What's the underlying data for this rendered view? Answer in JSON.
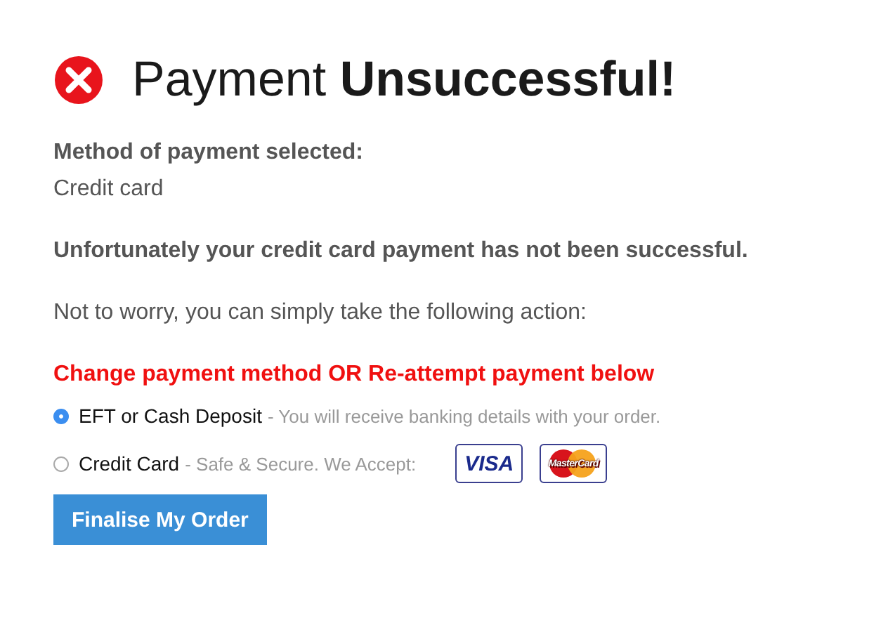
{
  "title": {
    "prefix": "Payment",
    "emphasis": "Unsuccessful!"
  },
  "method_label": "Method of payment selected:",
  "method_value": "Credit card",
  "failure_message": "Unfortunately your credit card payment has not been successful.",
  "info_message": "Not to worry, you can simply take the following action:",
  "action_heading": "Change payment method OR Re-attempt payment below",
  "options": [
    {
      "label": "EFT or Cash Deposit",
      "note": "- You will receive banking details with your order.",
      "selected": true
    },
    {
      "label": "Credit Card",
      "note": "- Safe & Secure. We Accept:",
      "selected": false,
      "cards": [
        {
          "kind": "visa",
          "label": "VISA"
        },
        {
          "kind": "mastercard",
          "label": "MasterCard"
        }
      ]
    }
  ],
  "button": "Finalise My Order"
}
